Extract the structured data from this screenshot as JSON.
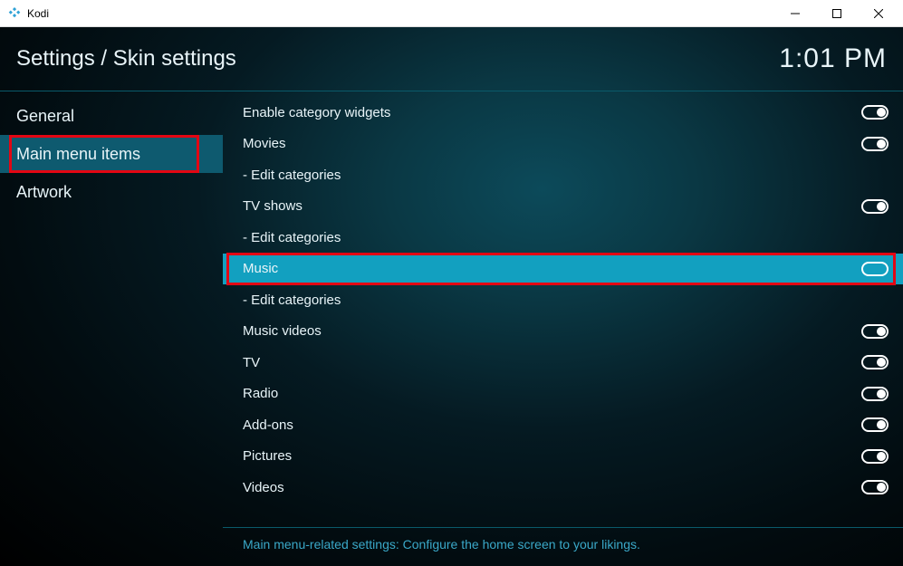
{
  "titlebar": {
    "app_name": "Kodi"
  },
  "header": {
    "breadcrumb": "Settings / Skin settings",
    "clock": "1:01 PM"
  },
  "sidebar": {
    "items": [
      {
        "label": "General",
        "active": false
      },
      {
        "label": "Main menu items",
        "active": true,
        "highlighted": true
      },
      {
        "label": "Artwork",
        "active": false
      }
    ]
  },
  "settings": {
    "rows": [
      {
        "label": "Enable category widgets",
        "type": "toggle",
        "value": true
      },
      {
        "label": "Movies",
        "type": "toggle",
        "value": true
      },
      {
        "label": "Edit categories",
        "type": "sub"
      },
      {
        "label": "TV shows",
        "type": "toggle",
        "value": true
      },
      {
        "label": "Edit categories",
        "type": "sub"
      },
      {
        "label": "Music",
        "type": "toggle",
        "value": true,
        "selected": true,
        "highlighted": true
      },
      {
        "label": "Edit categories",
        "type": "sub"
      },
      {
        "label": "Music videos",
        "type": "toggle",
        "value": true
      },
      {
        "label": "TV",
        "type": "toggle",
        "value": true
      },
      {
        "label": "Radio",
        "type": "toggle",
        "value": true
      },
      {
        "label": "Add-ons",
        "type": "toggle",
        "value": true
      },
      {
        "label": "Pictures",
        "type": "toggle",
        "value": true
      },
      {
        "label": "Videos",
        "type": "toggle",
        "value": true
      }
    ]
  },
  "footer": {
    "description": "Main menu-related settings: Configure the home screen to your likings."
  }
}
